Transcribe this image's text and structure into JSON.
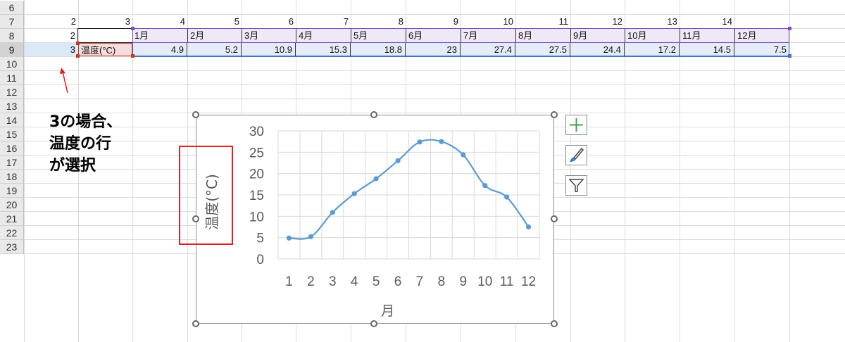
{
  "rows": [
    "6",
    "7",
    "8",
    "9",
    "10",
    "11",
    "12",
    "13",
    "14",
    "15",
    "16",
    "17",
    "18",
    "19",
    "20",
    "21",
    "22",
    "23"
  ],
  "row7_numbers": [
    "2",
    "3",
    "4",
    "5",
    "6",
    "7",
    "8",
    "9",
    "10",
    "11",
    "12",
    "13",
    "14"
  ],
  "a8": "2",
  "a9": "3",
  "label_cell": "温度(°C)",
  "months": [
    "1月",
    "2月",
    "3月",
    "4月",
    "5月",
    "6月",
    "7月",
    "8月",
    "9月",
    "10月",
    "11月",
    "12月"
  ],
  "temps": [
    "4.9",
    "5.2",
    "10.9",
    "15.3",
    "18.8",
    "23",
    "27.4",
    "27.5",
    "24.4",
    "17.2",
    "14.5",
    "7.5"
  ],
  "note_lines": [
    "3の場合、",
    "温度の行",
    "が選択"
  ],
  "chart_data": {
    "type": "line",
    "x": [
      1,
      2,
      3,
      4,
      5,
      6,
      7,
      8,
      9,
      10,
      11,
      12
    ],
    "categories": [
      "1",
      "2",
      "3",
      "4",
      "5",
      "6",
      "7",
      "8",
      "9",
      "10",
      "11",
      "12"
    ],
    "series": [
      {
        "values": [
          4.9,
          5.2,
          10.9,
          15.3,
          18.8,
          23,
          27.4,
          27.5,
          24.4,
          17.2,
          14.5,
          7.5
        ]
      }
    ],
    "ylim": [
      0,
      30
    ],
    "yticks": [
      "0",
      "5",
      "10",
      "15",
      "20",
      "25",
      "30"
    ],
    "xlabel": "月",
    "ylabel": "温度(°C)",
    "grid": true,
    "line_color": "#5b9bd5",
    "smooth": true
  },
  "colors": {
    "highlight_red": "#e02020",
    "selection_purple": "#7e4fbd",
    "selection_blue": "#4472c4",
    "selection_red": "#c0392b"
  }
}
